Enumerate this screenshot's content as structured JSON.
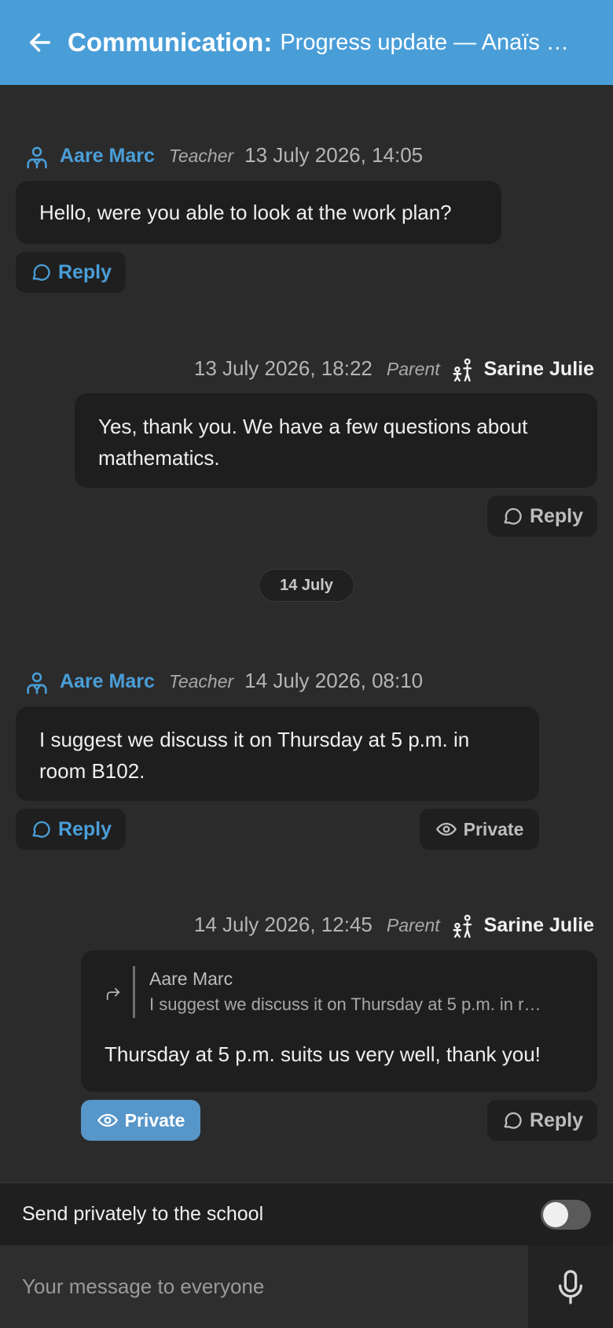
{
  "header": {
    "title": "Communication:",
    "subtitle": "Progress update — Anaïs …",
    "back_icon": "arrow-left-icon"
  },
  "messages": [
    {
      "author": "Aare Marc",
      "role": "Teacher",
      "date": "13 July 2026, 14:05",
      "text": "Hello, were you able to look at the work plan?",
      "reply_label": "Reply"
    },
    {
      "author": "Sarine Julie",
      "role": "Parent",
      "date": "13 July 2026, 18:22",
      "text": "Yes, thank you. We have a few questions about mathematics.",
      "reply_label": "Reply"
    },
    {
      "author": "Aare Marc",
      "role": "Teacher",
      "date": "14 July 2026, 08:10",
      "text": "I suggest we discuss it on Thursday at 5 p.m. in room B102.",
      "reply_label": "Reply",
      "private_label": "Private"
    },
    {
      "author": "Sarine Julie",
      "role": "Parent",
      "date": "14 July 2026, 12:45",
      "quote_author": "Aare Marc",
      "quote_text": "I suggest we discuss it on Thursday at 5 p.m. in r…",
      "text": "Thursday at 5 p.m. suits us very well, thank you!",
      "reply_label": "Reply",
      "private_label": "Private"
    }
  ],
  "date_separator": "14 July",
  "private_toggle": {
    "label": "Send privately to the school",
    "enabled": false
  },
  "composer": {
    "placeholder": "Your message to everyone",
    "mic_icon": "microphone-icon"
  },
  "colors": {
    "header": "#4a9ed8",
    "accent": "#4a9ed8",
    "background": "#2b2b2b",
    "bubble": "#1e1e1e",
    "private_active": "#5796c9"
  }
}
